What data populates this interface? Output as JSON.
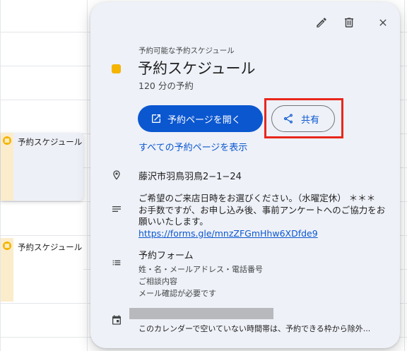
{
  "background_events": [
    {
      "label": "予約スケジュール"
    },
    {
      "label": "予約スケジュール"
    }
  ],
  "popup": {
    "toolbar": {
      "edit_icon": "pencil-icon",
      "delete_icon": "trash-icon",
      "close_icon": "close-icon"
    },
    "color": "#f4b400",
    "kind_label": "予約可能な予約スケジュール",
    "title": "予約スケジュール",
    "duration": "120 分の予約",
    "open_page_button": "予約ページを開く",
    "share_button": "共有",
    "all_pages_link": "すべての予約ページを表示",
    "location": "藤沢市羽鳥羽鳥2−1−24",
    "description": {
      "text": "ご希望のご来店日時をお選びください。（水曜定休） ＊＊＊ お手数ですが、お申し込み後、事前アンケートへのご協力をお願いいたします。",
      "link": "https://forms.gle/mnzZFGmHhw6XDfde9"
    },
    "form": {
      "title": "予約フォーム",
      "fields": "姓・名・メールアドレス・電話番号",
      "extra": "ご相談内容",
      "email_note": "メール確認が必要です"
    },
    "calendar_note": "このカレンダーで空いていない時間帯は、予約できる枠から除外..."
  },
  "colors": {
    "accent": "#0b57d0",
    "highlight_box": "#e8271c",
    "event_yellow": "#f4b400"
  }
}
